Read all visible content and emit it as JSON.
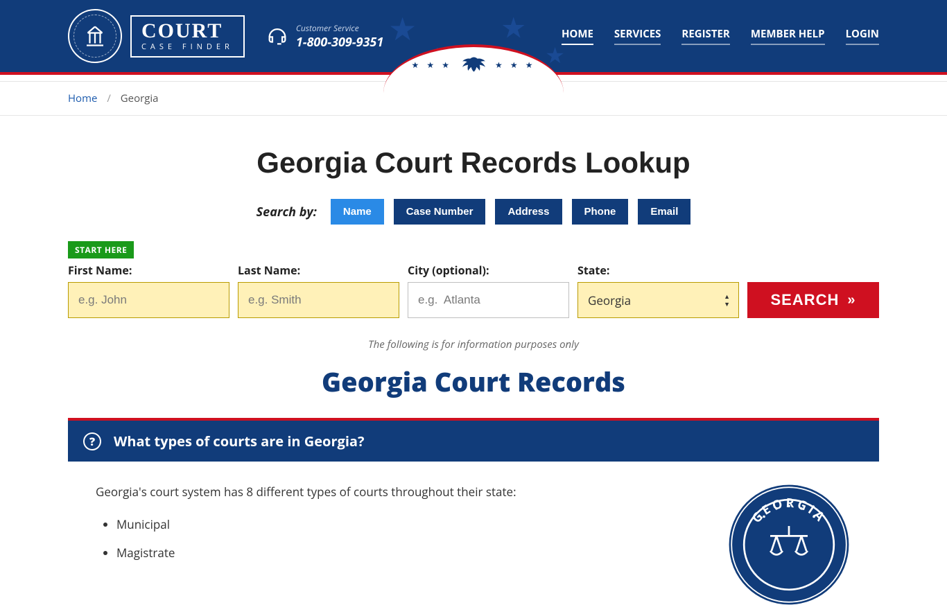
{
  "brand": {
    "title": "COURT",
    "subtitle": "CASE FINDER"
  },
  "support": {
    "label": "Customer Service",
    "phone": "1-800-309-9351"
  },
  "nav": {
    "items": [
      {
        "label": "HOME",
        "active": true
      },
      {
        "label": "SERVICES"
      },
      {
        "label": "REGISTER"
      },
      {
        "label": "MEMBER HELP"
      },
      {
        "label": "LOGIN"
      }
    ]
  },
  "breadcrumb": {
    "home": "Home",
    "current": "Georgia"
  },
  "page": {
    "title": "Georgia Court Records Lookup"
  },
  "search": {
    "by_label": "Search by:",
    "tabs": [
      "Name",
      "Case Number",
      "Address",
      "Phone",
      "Email"
    ],
    "start_here": "START HERE",
    "fields": {
      "first": {
        "label": "First Name:",
        "placeholder": "e.g. John"
      },
      "last": {
        "label": "Last Name:",
        "placeholder": "e.g. Smith"
      },
      "city": {
        "label": "City (optional):",
        "placeholder": "e.g.  Atlanta"
      },
      "state": {
        "label": "State:",
        "value": "Georgia"
      }
    },
    "button": "SEARCH"
  },
  "disclaimer": "The following is for information purposes only",
  "section": {
    "title": "Georgia Court Records"
  },
  "panel": {
    "question": "What types of courts are in Georgia?",
    "intro": "Georgia's court system has 8 different types of courts throughout their state:",
    "courts": [
      "Municipal",
      "Magistrate"
    ],
    "seal_top": "GEORGIA"
  }
}
